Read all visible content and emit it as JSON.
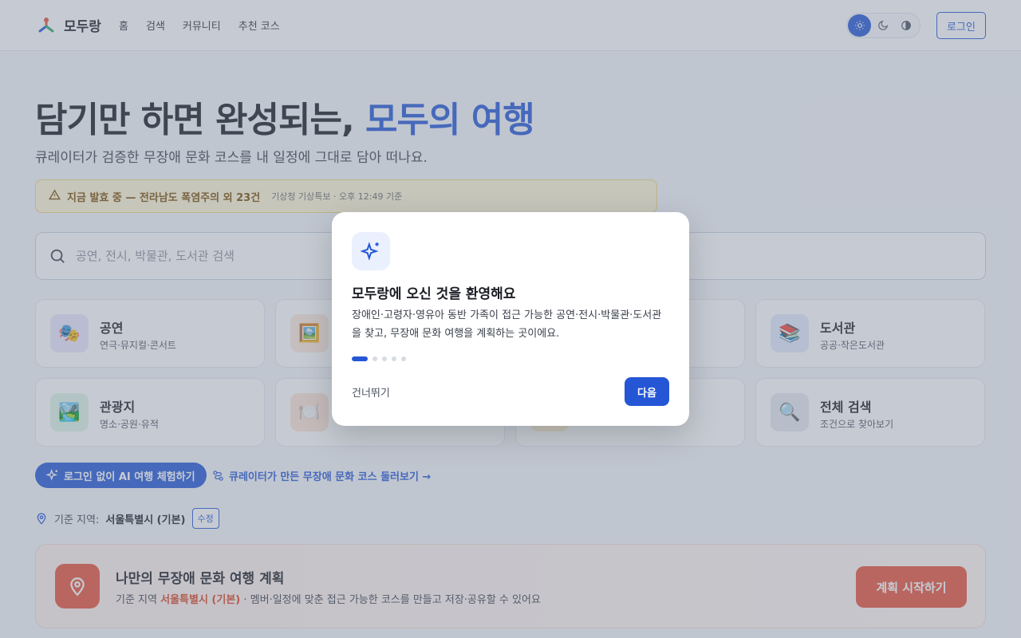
{
  "header": {
    "logo_text": "모두랑",
    "nav": [
      "홈",
      "검색",
      "커뮤니티",
      "추천 코스"
    ],
    "theme_icons": [
      "sun-icon",
      "moon-icon",
      "contrast-icon"
    ],
    "login_label": "로그인"
  },
  "hero": {
    "title_main": "담기만 하면 완성되는, ",
    "title_accent": "모두의 여행",
    "subtitle": "큐레이터가 검증한 무장애 문화 코스를 내 일정에 그대로 담아 떠나요."
  },
  "alert": {
    "icon": "warning-icon",
    "main": "지금 발효 중 — 전라남도 폭염주의 외 23건",
    "meta": "기상청 기상특보 · 오후 12:49 기준"
  },
  "search": {
    "placeholder": "공연, 전시, 박물관, 도서관 검색",
    "value": ""
  },
  "categories": [
    {
      "title": "공연",
      "desc": "연극·뮤지컬·콘서트",
      "icon": "🎭",
      "icon_name": "theater-masks-icon",
      "bg": "#ebe6fb"
    },
    {
      "title": "",
      "desc": "",
      "icon": "🖼️",
      "icon_name": "framed-picture-icon",
      "bg": "#fde9dc"
    },
    {
      "title": "",
      "desc": "",
      "icon": "",
      "icon_name": "museum-icon",
      "bg": "#fdf1d8"
    },
    {
      "title": "도서관",
      "desc": "공공·작은도서관",
      "icon": "📚",
      "icon_name": "books-icon",
      "bg": "#e3ebfb"
    },
    {
      "title": "관광지",
      "desc": "명소·공원·유적",
      "icon": "🏞️",
      "icon_name": "park-icon",
      "bg": "#def3e6"
    },
    {
      "title": "",
      "desc": "",
      "icon": "🍽️",
      "icon_name": "restaurant-icon",
      "bg": "#fde4d4"
    },
    {
      "title": "",
      "desc": "",
      "icon": "",
      "icon_name": "accommodation-icon",
      "bg": "#fdf0d0"
    },
    {
      "title": "전체 검색",
      "desc": "조건으로 찾아보기",
      "icon": "🔍",
      "icon_name": "magnifier-icon",
      "bg": "#e6e9ef"
    }
  ],
  "actions": {
    "ai_label": "로그인 없이 AI 여행 체험하기",
    "curator_label": "큐레이터가 만든 무장애 문화 코스 둘러보기 →"
  },
  "region": {
    "label": "기준 지역:",
    "value": "서울특별시 (기본)",
    "edit_label": "수정"
  },
  "plan": {
    "title": "나만의 무장애 문화 여행 계획",
    "desc_prefix": "기준 지역 ",
    "desc_region": "서울특별시 (기본)",
    "desc_suffix": " · 멤버·일정에 맞춘 접근 가능한 코스를 만들고 저장·공유할 수 있어요",
    "button": "계획 시작하기"
  },
  "modal": {
    "title": "모두랑에 오신 것을 환영해요",
    "text": "장애인·고령자·영유아 동반 가족이 접근 가능한 공연·전시·박물관·도서관을 찾고, 무장애 문화 여행을 계획하는 곳이에요.",
    "step_current": 1,
    "step_total": 5,
    "skip_label": "건너뛰기",
    "next_label": "다음"
  },
  "colors": {
    "primary": "#2456d6",
    "accent_orange": "#e9523a",
    "alert_bg": "#fff6d6",
    "alert_text": "#7a4d00"
  }
}
